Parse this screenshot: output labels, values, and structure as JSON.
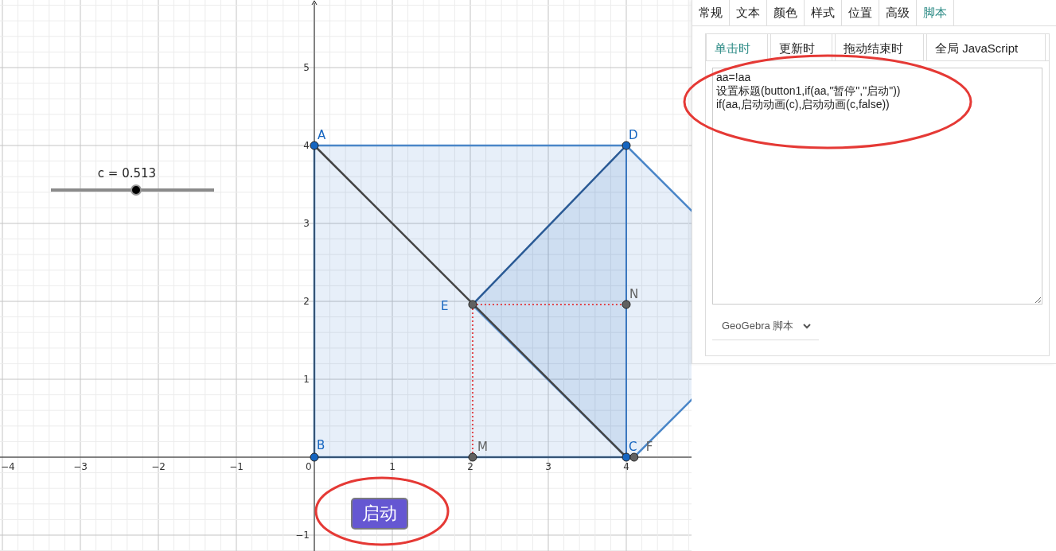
{
  "graphics": {
    "x_ticks": [
      "−4",
      "−3",
      "−2",
      "−1",
      "0",
      "1",
      "2",
      "3",
      "4"
    ],
    "y_ticks": [
      "5",
      "4",
      "3",
      "2",
      "1",
      "−1"
    ],
    "points": [
      {
        "label": "A",
        "kind": "free",
        "color": "#1565c0"
      },
      {
        "label": "D",
        "kind": "free",
        "color": "#1565c0"
      },
      {
        "label": "E",
        "kind": "dependent",
        "color": "#1565c0"
      },
      {
        "label": "N",
        "kind": "dependent",
        "color": "#616161"
      },
      {
        "label": "B",
        "kind": "free",
        "color": "#1565c0"
      },
      {
        "label": "M",
        "kind": "dependent",
        "color": "#616161"
      },
      {
        "label": "C",
        "kind": "free",
        "color": "#1565c0"
      },
      {
        "label": "F",
        "kind": "dependent",
        "color": "#616161"
      }
    ],
    "slider": {
      "label": "c = 0.513",
      "level": 0.52
    },
    "button": {
      "label": "启动"
    }
  },
  "panel": {
    "tabs": [
      {
        "label": "常规",
        "selected": false
      },
      {
        "label": "文本",
        "selected": false
      },
      {
        "label": "颜色",
        "selected": false
      },
      {
        "label": "样式",
        "selected": false
      },
      {
        "label": "位置",
        "selected": false
      },
      {
        "label": "高级",
        "selected": false
      },
      {
        "label": "脚本",
        "selected": true
      }
    ],
    "script_tabs": [
      {
        "label": "单击时",
        "selected": true
      },
      {
        "label": "更新时",
        "selected": false
      },
      {
        "label": "拖动结束时",
        "selected": false
      },
      {
        "label": "全局 JavaScript",
        "selected": false
      }
    ],
    "script_lines": [
      "aa=!aa",
      "设置标题(button1,if(aa,\"暂停\",\"启动\"))",
      "if(aa,启动动画(c),启动动画(c,false))"
    ],
    "language": "GeoGebra 脚本"
  }
}
